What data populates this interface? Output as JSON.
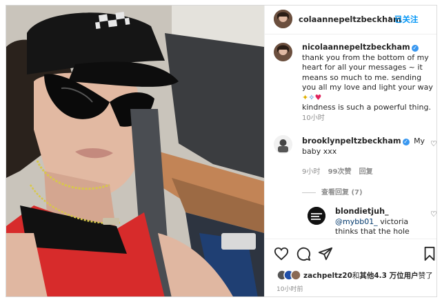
{
  "header": {
    "username": "colaannepeltzbeckham",
    "dot": "•",
    "follow_label": "已关注"
  },
  "caption": {
    "username": "nicolaannepeltzbeckham",
    "text": "thank you from the bottom of my heart for all your messages ~ it means so much to me. sending you all my love and light your way",
    "text2": "kindness is such a powerful thing.",
    "time": "10小时"
  },
  "comments": [
    {
      "username": "brooklynpeltzbeckham",
      "text": "My baby xxx",
      "time": "9小时",
      "likes": "99次赞",
      "reply": "回复"
    },
    {
      "username": "blondietjuh_",
      "mention": "@mybb01_",
      "text": "victoria thinks that the hole world is about here, she dont now what"
    }
  ],
  "view_replies": "查看回复 (7)",
  "likes": {
    "user": "zachpeltz20",
    "and": "和",
    "others": "其他4.3 万位用户",
    "suffix": "赞了"
  },
  "post_time": "10小时前",
  "colors": {
    "link": "#0095f6",
    "verified": "#3897f0",
    "secondary_text": "#8e8e8e",
    "heart": "#e0245e"
  },
  "icons": [
    "like-icon",
    "comment-icon",
    "share-icon",
    "save-icon",
    "verified-icon",
    "small-heart-icon"
  ]
}
